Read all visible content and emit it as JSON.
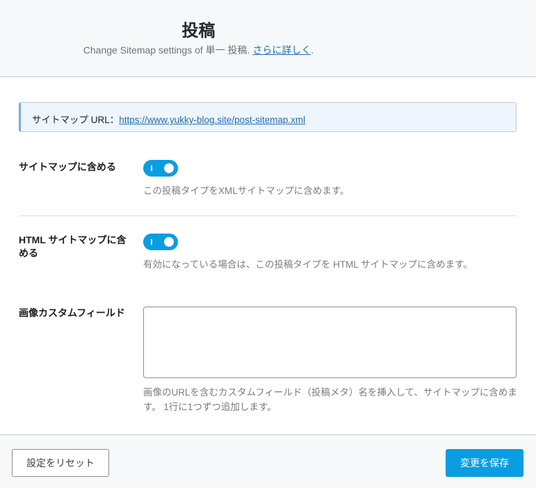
{
  "header": {
    "title": "投稿",
    "subtitle_prefix": "Change Sitemap settings of 単一 投稿.",
    "learn_more": "さらに詳しく",
    "subtitle_suffix": "."
  },
  "notice": {
    "label": "サイトマップ URL：",
    "url": "https://www.yukky-blog.site/post-sitemap.xml"
  },
  "settings": [
    {
      "label": "サイトマップに含める",
      "enabled": true,
      "description": "この投稿タイプをXMLサイトマップに含めます。"
    },
    {
      "label": "HTML サイトマップに含める",
      "enabled": true,
      "description": "有効になっている場合は、この投稿タイプを HTML サイトマップに含めます。"
    },
    {
      "label": "画像カスタムフィールド",
      "value": "",
      "description": "画像のURLを含むカスタムフィールド（投稿メタ）名を挿入して、サイトマップに含めます。 1行に1つずつ追加します。"
    }
  ],
  "footer": {
    "reset_label": "設定をリセット",
    "save_label": "変更を保存"
  },
  "colors": {
    "accent": "#0a9de2"
  }
}
